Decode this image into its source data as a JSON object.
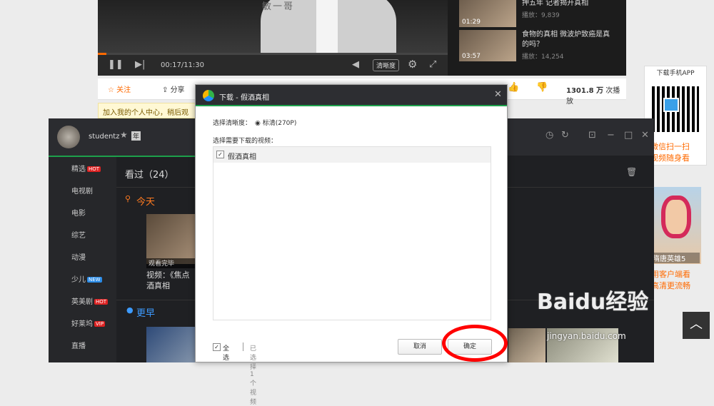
{
  "player": {
    "video_caption": "敏一哥",
    "time_current": "00:17",
    "time_total": "/11:30",
    "quality": "清晰度",
    "progress_percent": 2.4
  },
  "playlist": [
    {
      "title": "押五年 记者揭开真相",
      "count": "播放：9,839",
      "duration": "01:29"
    },
    {
      "title": "食物的真相 微波炉致癌是真的吗？",
      "count": "播放：14,254",
      "duration": "03:57"
    }
  ],
  "actionbar": {
    "follow": "关注",
    "share": "分享",
    "views": "1301.8 万",
    "views_suffix": " 次播放"
  },
  "notice": "加入我的个人中心，稍后观",
  "app_ad": {
    "title": "下载手机APP",
    "line1": "微信扫一扫",
    "line2": "视频随身看"
  },
  "ad2": {
    "caption": "隋唐英雄5",
    "line1": "用客户端看",
    "line2": "高清更流畅"
  },
  "client": {
    "username": "studentz",
    "level": "年",
    "sidebar": [
      {
        "label": "精选",
        "tag": "HOT",
        "tag_type": "hot"
      },
      {
        "label": "电视剧",
        "tag": "",
        "tag_type": ""
      },
      {
        "label": "电影",
        "tag": "",
        "tag_type": ""
      },
      {
        "label": "综艺",
        "tag": "",
        "tag_type": ""
      },
      {
        "label": "动漫",
        "tag": "",
        "tag_type": ""
      },
      {
        "label": "少儿",
        "tag": "NEW",
        "tag_type": "new"
      },
      {
        "label": "英美剧",
        "tag": "HOT",
        "tag_type": "hot"
      },
      {
        "label": "好莱坞",
        "tag": "VIP",
        "tag_type": "vip"
      },
      {
        "label": "直播",
        "tag": "",
        "tag_type": ""
      }
    ],
    "watched_head": "看过（24）",
    "today": "今天",
    "card1_status": "观看完毕",
    "card1_title1": "视频：《焦点",
    "card1_title2": "酒真相",
    "earlier": "更早"
  },
  "dialog": {
    "title": "下载 - 假酒真相",
    "quality_label": "选择清晰度：",
    "quality_option": "标清(270P)",
    "select_label": "选择需要下载的视频：",
    "item_label": "假酒真相",
    "select_all": "全选",
    "selected_count": "已选择1个视频",
    "cancel": "取消",
    "ok": "确定"
  },
  "watermark": {
    "logo": "Baidu经验",
    "url": "jingyan.baidu.com"
  },
  "icons": {
    "pause": "pause-icon",
    "next": "next-icon",
    "volume": "volume-icon",
    "settings": "gear-icon",
    "fullscreen": "fullscreen-icon",
    "close": "close-icon",
    "to_top": "chevron-up-icon"
  },
  "colors": {
    "accent_orange": "#ff6a00",
    "green_bar": "#1da04b",
    "circle_red": "#ff0000"
  }
}
